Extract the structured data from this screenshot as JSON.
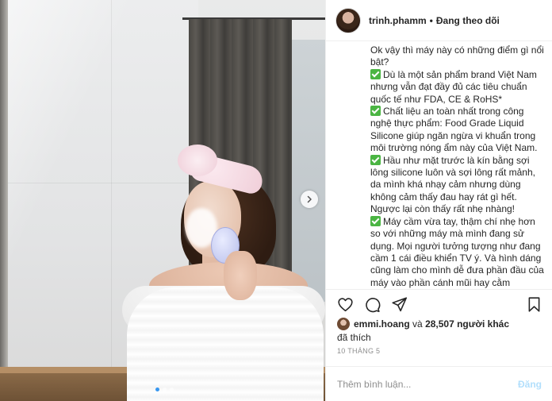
{
  "post": {
    "username": "trinh.phamm",
    "separator": "•",
    "follow_status": "Đang theo dõi",
    "caption_lines": [
      {
        "check": false,
        "text": "Ok vậy thì máy này có những điểm gì nổi bật?"
      },
      {
        "check": true,
        "text": "Dù là một sản phẩm brand Việt Nam nhưng vẫn đạt đầy đủ các tiêu chuẩn quốc tế như FDA, CE & RoHS*"
      },
      {
        "check": true,
        "text": "Chất liệu an toàn nhất trong công nghệ thực phẩm: Food Grade Liquid Silicone giúp ngăn ngừa vi khuẩn trong môi trường nóng ẩm này của Việt Nam."
      },
      {
        "check": true,
        "text": "Hầu như mặt trước là kín bằng sợi lông silicone luôn và sợi lông rất mảnh, da mình khá nhạy cảm nhưng dùng không cảm thấy đau hay rát gì hết. Ngược lại còn thấy rất nhẹ nhàng!"
      },
      {
        "check": true,
        "text": "Máy cầm vừa tay, thậm chí nhẹ hơn so với những máy mà mình đang sử dụng. Mọi người tưởng tượng như đang cầm 1 cái điều khiển TV ý. Và hình dáng cũng làm cho mình dễ đưa phần đầu của máy vào phần cánh mũi hay cằm"
      }
    ],
    "likes": {
      "first_liker": "emmi.hoang",
      "connector": "và",
      "count_text": "28,507 người khác",
      "liked_label": "đã thích"
    },
    "date": "10 THÁNG 5",
    "comment": {
      "placeholder": "Thêm bình luận...",
      "post_label": "Đăng"
    }
  },
  "icons": {
    "like": "heart-icon",
    "comment": "comment-icon",
    "share": "share-icon",
    "save": "bookmark-icon",
    "next": "chevron-right-icon",
    "checkmark": "check-mark-icon"
  },
  "colors": {
    "check_green": "#4bb543",
    "carousel_active": "#3897f0",
    "post_button_disabled": "#b2dffc",
    "muted_text": "#8e8e8e"
  },
  "carousel": {
    "total": 3,
    "active_index": 0
  }
}
